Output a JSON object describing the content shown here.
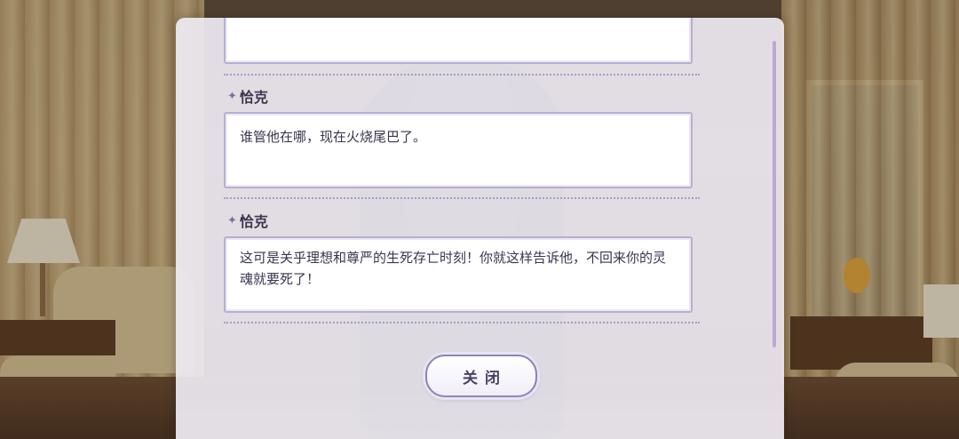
{
  "dialog_log": {
    "entries": [
      {
        "speaker": "",
        "text": ""
      },
      {
        "speaker": "恰克",
        "text": "谁管他在哪，现在火烧尾巴了。"
      },
      {
        "speaker": "恰克",
        "text": "这可是关乎理想和尊严的生死存亡时刻！你就这样告诉他，不回来你的灵魂就要死了！"
      }
    ]
  },
  "close_button": {
    "label": "关闭"
  },
  "colors": {
    "panel_bg": "#eeeaf2",
    "accent": "#8e82b8",
    "text": "#3b3450"
  },
  "icons": {
    "speaker_marker": "sparkle-icon"
  }
}
